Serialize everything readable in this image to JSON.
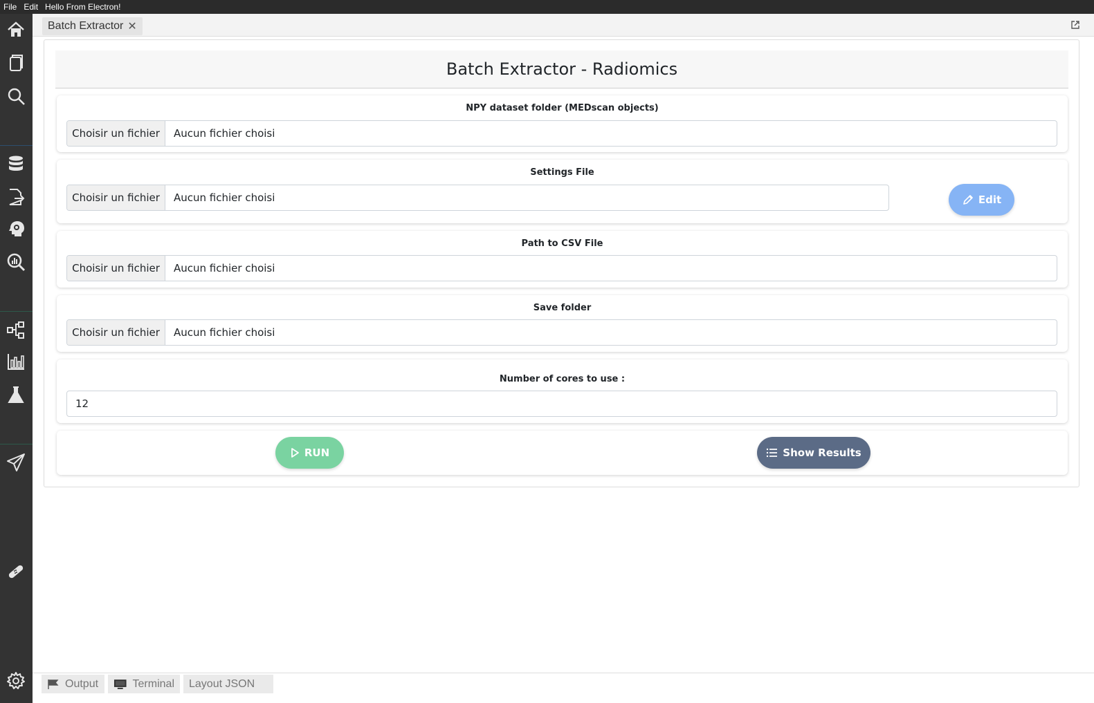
{
  "menubar": {
    "items": [
      "File",
      "Edit",
      "Hello From Electron!"
    ]
  },
  "sidebar": {
    "icons": [
      "home-icon",
      "pages-icon",
      "search-icon",
      "database-icon",
      "file-export-icon",
      "brain-gear-icon",
      "search-chart-icon",
      "flow-icon",
      "bar-chart-icon",
      "flask-icon",
      "send-icon",
      "bandage-icon",
      "settings-icon"
    ]
  },
  "tabs": {
    "active": {
      "label": "Batch Extractor",
      "close": "✕"
    }
  },
  "page": {
    "title": "Batch Extractor - Radiomics",
    "npy": {
      "label": "NPY dataset folder (MEDscan objects)",
      "button": "Choisir un fichier",
      "value": "Aucun fichier choisi"
    },
    "settings": {
      "label": "Settings File",
      "button": "Choisir un fichier",
      "value": "Aucun fichier choisi",
      "edit_label": "Edit"
    },
    "csv": {
      "label": "Path to CSV File",
      "button": "Choisir un fichier",
      "value": "Aucun fichier choisi"
    },
    "save": {
      "label": "Save folder",
      "button": "Choisir un fichier",
      "value": "Aucun fichier choisi"
    },
    "cores": {
      "label": "Number of cores to use :",
      "value": "12"
    },
    "actions": {
      "run_label": "RUN",
      "results_label": "Show Results"
    }
  },
  "bottom_tabs": {
    "output": "Output",
    "terminal": "Terminal",
    "layout": "Layout JSON"
  },
  "colors": {
    "run": "#7ad3a1",
    "results": "#5b6b86",
    "edit": "#86b4f5",
    "sidebar": "#333333",
    "menubar": "#2b2b2b"
  }
}
